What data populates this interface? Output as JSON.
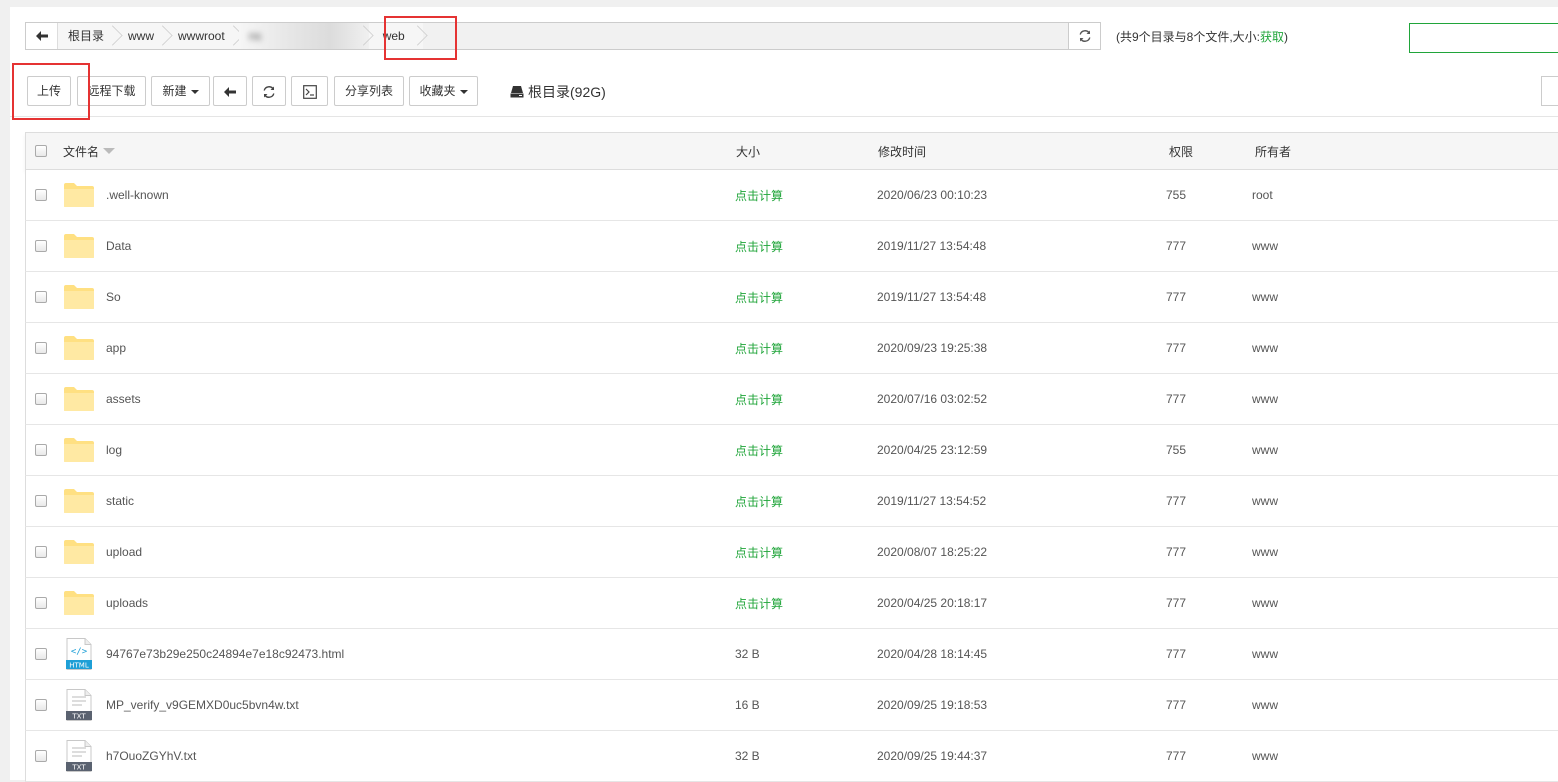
{
  "pathbar": {
    "crumbs": [
      "根目录",
      "www",
      "wwwroot",
      "ns",
      "web"
    ],
    "summary_prefix": "(共9个目录与8个文件,大小:",
    "summary_fetch": "获取",
    "summary_suffix": ")",
    "search_value": ""
  },
  "toolbar": {
    "upload": "上传",
    "remote_download": "远程下载",
    "new": "新建",
    "share_list": "分享列表",
    "favorites": "收藏夹",
    "disk": "根目录(92G)"
  },
  "table": {
    "headers": {
      "name": "文件名",
      "size": "大小",
      "mtime": "修改时间",
      "perm": "权限",
      "owner": "所有者"
    },
    "rows": [
      {
        "name": ".well-known",
        "type": "folder",
        "size": "点击计算",
        "mtime": "2020/06/23 00:10:23",
        "perm": "755",
        "owner": "root"
      },
      {
        "name": "Data",
        "type": "folder",
        "size": "点击计算",
        "mtime": "2019/11/27 13:54:48",
        "perm": "777",
        "owner": "www"
      },
      {
        "name": "So",
        "type": "folder",
        "size": "点击计算",
        "mtime": "2019/11/27 13:54:48",
        "perm": "777",
        "owner": "www"
      },
      {
        "name": "app",
        "type": "folder",
        "size": "点击计算",
        "mtime": "2020/09/23 19:25:38",
        "perm": "777",
        "owner": "www"
      },
      {
        "name": "assets",
        "type": "folder",
        "size": "点击计算",
        "mtime": "2020/07/16 03:02:52",
        "perm": "777",
        "owner": "www"
      },
      {
        "name": "log",
        "type": "folder",
        "size": "点击计算",
        "mtime": "2020/04/25 23:12:59",
        "perm": "755",
        "owner": "www"
      },
      {
        "name": "static",
        "type": "folder",
        "size": "点击计算",
        "mtime": "2019/11/27 13:54:52",
        "perm": "777",
        "owner": "www"
      },
      {
        "name": "upload",
        "type": "folder",
        "size": "点击计算",
        "mtime": "2020/08/07 18:25:22",
        "perm": "777",
        "owner": "www"
      },
      {
        "name": "uploads",
        "type": "folder",
        "size": "点击计算",
        "mtime": "2020/04/25 20:18:17",
        "perm": "777",
        "owner": "www"
      },
      {
        "name": "94767e73b29e250c24894e7e18c92473.html",
        "type": "html",
        "icon_label": "HTML",
        "size": "32 B",
        "mtime": "2020/04/28 18:14:45",
        "perm": "777",
        "owner": "www"
      },
      {
        "name": "MP_verify_v9GEMXD0uc5bvn4w.txt",
        "type": "txt",
        "icon_label": "TXT",
        "size": "16 B",
        "mtime": "2020/09/25 19:18:53",
        "perm": "777",
        "owner": "www"
      },
      {
        "name": "h7OuoZGYhV.txt",
        "type": "txt",
        "icon_label": "TXT",
        "size": "32 B",
        "mtime": "2020/09/25 19:44:37",
        "perm": "777",
        "owner": "www"
      }
    ]
  },
  "colors": {
    "accent": "#20a53a",
    "highlight": "#e53333",
    "folder": "#ffe58f"
  }
}
